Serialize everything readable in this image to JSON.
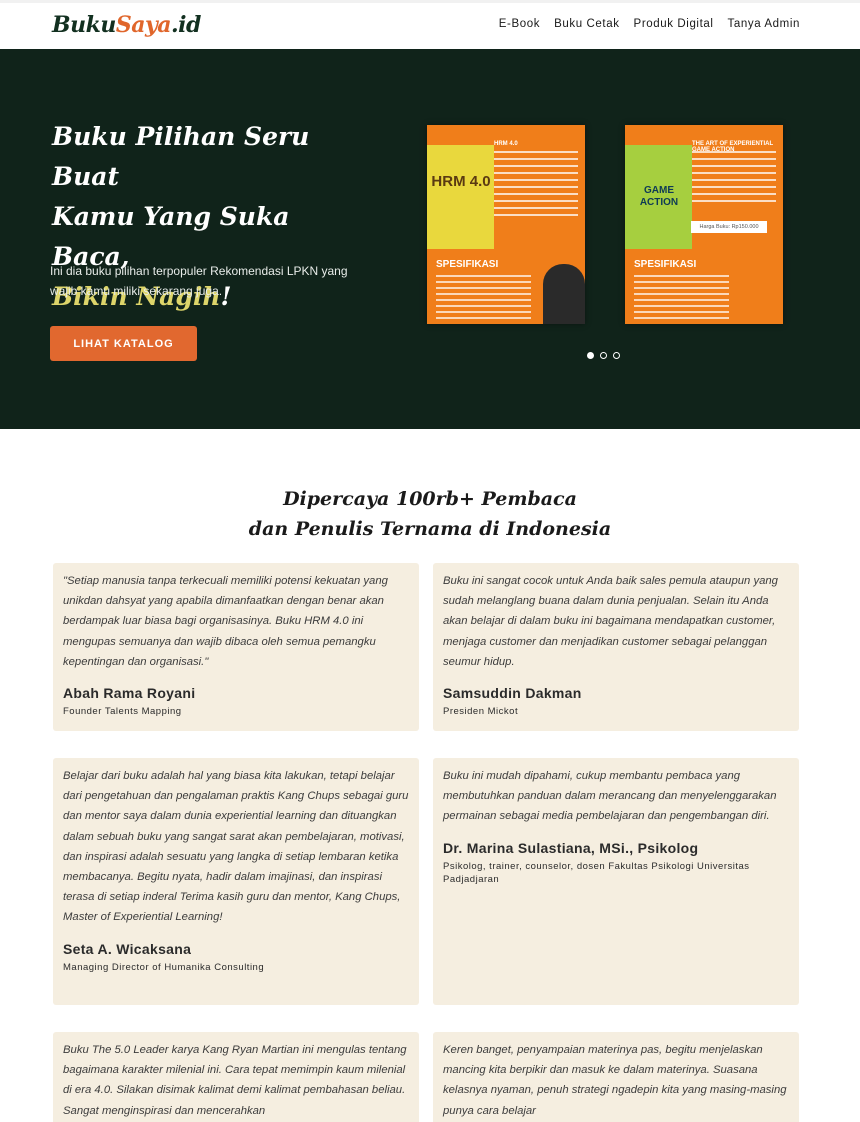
{
  "brand": {
    "part1": "Buku",
    "part2": "Saya",
    "part3": ".id"
  },
  "nav": {
    "items": [
      "E-Book",
      "Buku Cetak",
      "Produk Digital",
      "Tanya Admin"
    ]
  },
  "hero": {
    "title_line1": "Buku Pilihan Seru Buat",
    "title_line2": "Kamu Yang Suka Baca,",
    "title_highlight": "Bikin Nagih",
    "title_suffix": "!",
    "description": "Ini dia buku pilihan terpopuler Rekomendasi LPKN yang wajib kamu miliki sekarang juga.",
    "button": "LIHAT KATALOG",
    "slides": [
      {
        "cover_text": "HRM 4.0",
        "title": "HRM 4.0",
        "spec_label": "SPESIFIKASI"
      },
      {
        "cover_text": "GAME ACTION",
        "title": "THE ART OF EXPERIENTIAL GAME ACTION",
        "spec_label": "SPESIFIKASI",
        "price": "Harga Buku: Rp150.000"
      }
    ],
    "active_slide": 1,
    "slide_count": 3
  },
  "testimonials": {
    "heading_line1": "Dipercaya 100rb+ Pembaca",
    "heading_line2": "dan Penulis Ternama di Indonesia",
    "items": [
      {
        "quote": "\"Setiap manusia tanpa terkecuali memiliki potensi kekuatan yang unikdan dahsyat yang apabila dimanfaatkan dengan benar akan berdampak luar biasa bagi organisasinya. Buku HRM 4.0 ini mengupas semuanya dan wajib dibaca oleh semua pemangku kepentingan dan organisasi.\"",
        "name": "Abah Rama Royani",
        "role": "Founder Talents Mapping"
      },
      {
        "quote": "Buku ini sangat cocok untuk Anda baik sales pemula ataupun yang sudah melanglang buana dalam dunia penjualan. Selain itu Anda akan belajar di dalam buku ini bagaimana mendapatkan customer, menjaga customer dan menjadikan customer sebagai pelanggan seumur hidup.",
        "name": "Samsuddin Dakman",
        "role": "Presiden Mickot"
      },
      {
        "quote": "Belajar dari buku adalah hal yang biasa kita lakukan, tetapi belajar dari pengetahuan dan pengalaman praktis Kang Chups sebagai guru dan mentor saya dalam dunia experiential learning dan dituangkan dalam sebuah buku yang sangat sarat akan pembelajaran, motivasi, dan inspirasi adalah sesuatu yang langka di setiap lembaran ketika membacanya. Begitu nyata, hadir dalam imajinasi, dan inspirasi terasa di setiap inderal Terima kasih guru dan mentor, Kang Chups, Master of Experiential Learning!",
        "name": "Seta A. Wicaksana",
        "role": "Managing Director of Humanika Consulting"
      },
      {
        "quote": "Buku ini mudah dipahami, cukup membantu pembaca yang membutuhkan panduan dalam merancang dan menyelenggarakan permainan sebagai media pembelajaran dan pengembangan diri.",
        "name": "Dr. Marina Sulastiana, MSi., Psikolog",
        "role": "Psikolog, trainer, counselor, dosen Fakultas Psikologi Universitas Padjadjaran"
      },
      {
        "quote": "Buku The 5.0 Leader karya Kang Ryan Martian ini mengulas tentang bagaimana karakter milenial ini. Cara tepat memimpin kaum milenial di era 4.0. Silakan disimak kalimat demi kalimat pembahasan beliau. Sangat menginspirasi dan mencerahkan",
        "name": "",
        "role": ""
      },
      {
        "quote": "Keren banget, penyampaian materinya pas, begitu menjelaskan mancing kita berpikir dan masuk ke dalam materinya. Suasana kelasnya nyaman, penuh strategi ngadepin kita yang masing-masing punya cara belajar",
        "name": "",
        "role": ""
      }
    ]
  }
}
